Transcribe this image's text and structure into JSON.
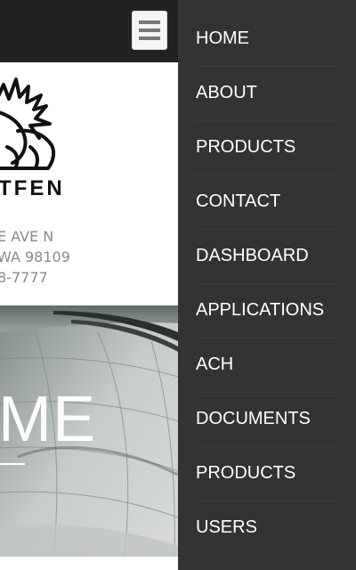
{
  "header": {
    "menu_icon": "hamburger-menu-icon"
  },
  "brand": {
    "logo_icon": "eagle-logo-icon",
    "name_visible": "TFEN"
  },
  "address": {
    "line1": "E AVE N",
    "line2": "WA 98109",
    "line3": "8-7777"
  },
  "hero": {
    "title": "ME"
  },
  "menu": {
    "items": [
      {
        "label": "HOME"
      },
      {
        "label": "ABOUT"
      },
      {
        "label": "PRODUCTS"
      },
      {
        "label": "CONTACT"
      },
      {
        "label": "DASHBOARD"
      },
      {
        "label": "APPLICATIONS"
      },
      {
        "label": "ACH"
      },
      {
        "label": "DOCUMENTS"
      },
      {
        "label": "PRODUCTS"
      },
      {
        "label": "USERS"
      }
    ]
  },
  "colors": {
    "topbar": "#222222",
    "drawer": "#333333",
    "drawer_text": "#ffffff",
    "address_text": "#8a8a8a"
  }
}
